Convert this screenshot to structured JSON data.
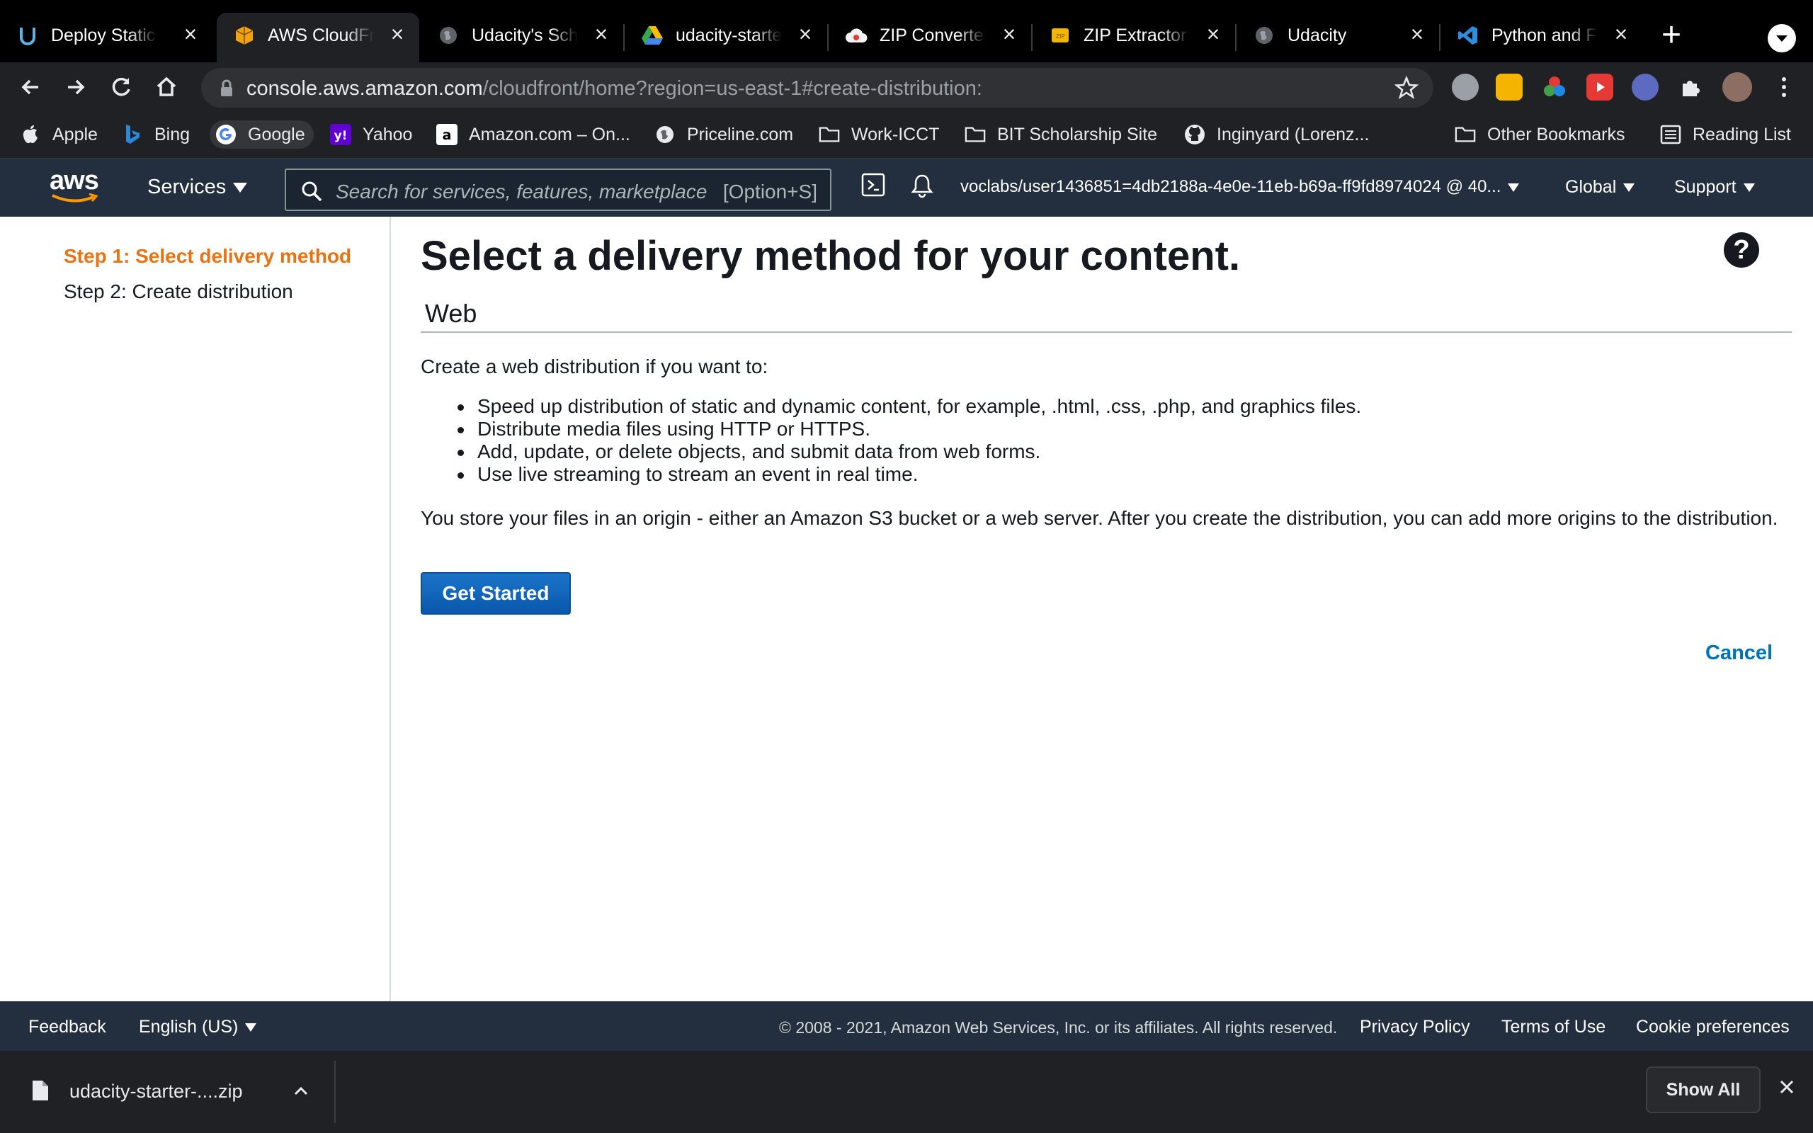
{
  "browser": {
    "tabs": [
      {
        "title": "Deploy Static",
        "icon": "udacity-icon"
      },
      {
        "title": "AWS CloudFront",
        "icon": "aws-cloudfront-icon",
        "active": true
      },
      {
        "title": "Udacity's School",
        "icon": "globe-icon"
      },
      {
        "title": "udacity-starter",
        "icon": "google-drive-icon"
      },
      {
        "title": "ZIP Converter",
        "icon": "cloud-convert-icon"
      },
      {
        "title": "ZIP Extractor",
        "icon": "zip-extractor-icon"
      },
      {
        "title": "Udacity",
        "icon": "globe-icon"
      },
      {
        "title": "Python and Flask",
        "icon": "vscode-icon"
      }
    ],
    "url_host": "console.aws.amazon.com",
    "url_path": "/cloudfront/home?region=us-east-1#create-distribution:",
    "bookmarks": [
      {
        "label": "Apple",
        "icon": "apple-icon"
      },
      {
        "label": "Bing",
        "icon": "bing-icon"
      },
      {
        "label": "Google",
        "icon": "google-icon"
      },
      {
        "label": "Yahoo",
        "icon": "yahoo-icon"
      },
      {
        "label": "Amazon.com – On...",
        "icon": "amazon-icon"
      },
      {
        "label": "Priceline.com",
        "icon": "globe-icon"
      },
      {
        "label": "Work-ICCT",
        "icon": "folder-icon"
      },
      {
        "label": "BIT Scholarship Site",
        "icon": "folder-icon"
      },
      {
        "label": "Inginyard (Lorenz...",
        "icon": "github-icon"
      }
    ],
    "other_bookmarks": "Other Bookmarks",
    "reading_list": "Reading List"
  },
  "aws_nav": {
    "logo": "aws",
    "services": "Services",
    "search_placeholder": "Search for services, features, marketplace",
    "search_shortcut": "[Option+S]",
    "account": "voclabs/user1436851=4db2188a-4e0e-11eb-b69a-ff9fd8974024 @ 40...",
    "region": "Global",
    "support": "Support"
  },
  "sidebar": {
    "step1": "Step 1: Select delivery method",
    "step2": "Step 2: Create distribution"
  },
  "main": {
    "heading": "Select a delivery method for your content.",
    "help": "?",
    "section": "Web",
    "intro": "Create a web distribution if you want to:",
    "bullets": [
      "Speed up distribution of static and dynamic content, for example, .html, .css, .php, and graphics files.",
      "Distribute media files using HTTP or HTTPS.",
      "Add, update, or delete objects, and submit data from web forms.",
      "Use live streaming to stream an event in real time."
    ],
    "origin_note": "You store your files in an origin - either an Amazon S3 bucket or a web server. After you create the distribution, you can add more origins to the distribution.",
    "get_started": "Get Started",
    "cancel": "Cancel"
  },
  "footer": {
    "feedback": "Feedback",
    "language": "English (US)",
    "copyright": "© 2008 - 2021, Amazon Web Services, Inc. or its affiliates. All rights reserved.",
    "privacy": "Privacy Policy",
    "terms": "Terms of Use",
    "cookies": "Cookie preferences"
  },
  "downloads": {
    "file": "udacity-starter-....zip",
    "show_all": "Show All"
  },
  "colors": {
    "aws_nav_bg": "#232f3e",
    "active_step": "#ec7211",
    "link": "#0073bb",
    "primary_button": "#0a58ad"
  }
}
